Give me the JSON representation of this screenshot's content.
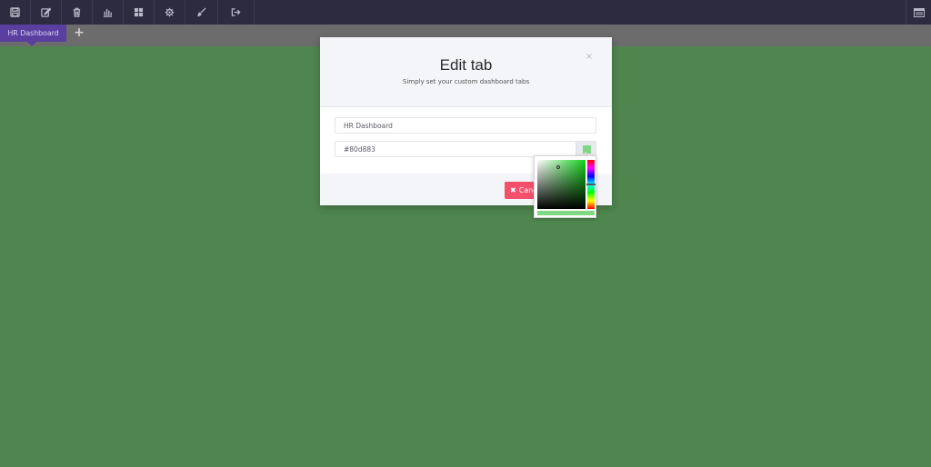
{
  "toolbar": {
    "buttons": [
      {
        "icon": "save-icon"
      },
      {
        "icon": "edit-icon"
      },
      {
        "icon": "trash-icon"
      },
      {
        "icon": "bar-chart-icon"
      },
      {
        "icon": "grid-icon"
      },
      {
        "icon": "gear-icon"
      },
      {
        "icon": "brush-icon"
      },
      {
        "icon": "logout-icon"
      }
    ],
    "right_icon": "panel-icon"
  },
  "tabs": {
    "active_label": "HR Dashboard",
    "add_label": "+"
  },
  "modal": {
    "title": "Edit tab",
    "subtitle": "Simply set your custom dashboard tabs",
    "close_label": "×",
    "name_value": "HR Dashboard",
    "color_value": "#80d883",
    "cancel_icon": "✖",
    "cancel_label": "Cancel"
  },
  "colors": {
    "background": "#4f854e",
    "toolbar": "#2d2b3f",
    "tab_active": "#5b3fa0",
    "selected_color": "#80d883",
    "cancel_button": "#f3506b"
  }
}
